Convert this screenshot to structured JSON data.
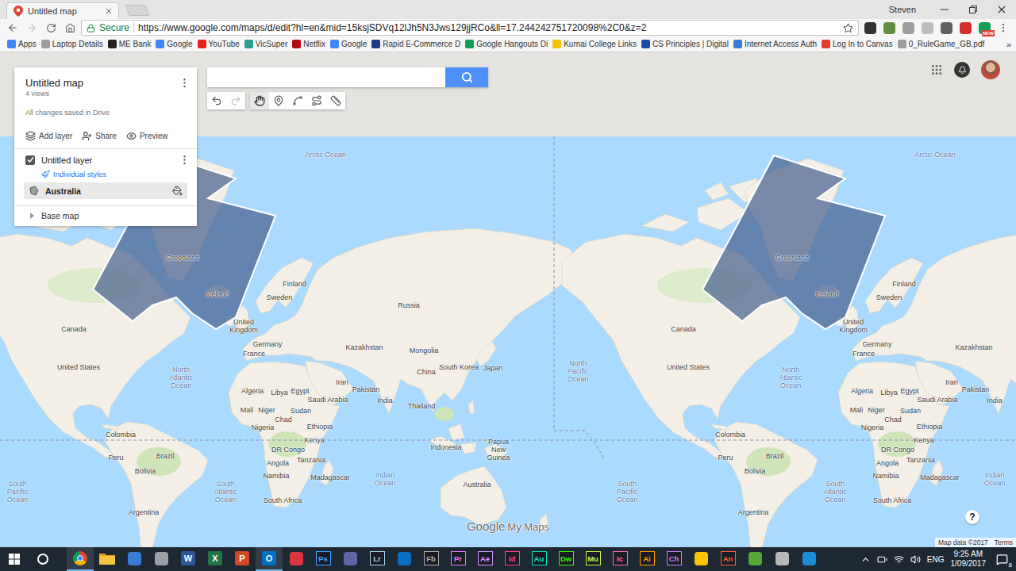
{
  "browser": {
    "tab_title": "Untitled map",
    "profile": "Steven",
    "secure": "Secure",
    "url": "https://www.google.com/maps/d/edit?hl=en&mid=15ksjSDVq12lJh5N3Jws129jjRCo&ll=17.244242751720098%2C0&z=2",
    "can_go_forward": false,
    "starred": false,
    "extensions": [
      {
        "color": "#333333"
      },
      {
        "color": "#5f8f3f"
      },
      {
        "color": "#9e9e9e"
      },
      {
        "color": "#bdbdbd"
      },
      {
        "color": "#616161"
      },
      {
        "color": "#d32f2f"
      },
      {
        "color": "#0f9d58",
        "badge": "NEW"
      }
    ],
    "bookmarks": [
      {
        "label": "Apps",
        "color": "#4285f4"
      },
      {
        "label": "Laptop Details",
        "color": "#9e9e9e"
      },
      {
        "label": "ME Bank",
        "color": "#222222"
      },
      {
        "label": "Google",
        "color": "#4285f4"
      },
      {
        "label": "YouTube",
        "color": "#e62117"
      },
      {
        "label": "VicSuper",
        "color": "#2a9d8f"
      },
      {
        "label": "Netflix",
        "color": "#b20710"
      },
      {
        "label": "Google",
        "color": "#4285f4"
      },
      {
        "label": "Rapid E-Commerce D",
        "color": "#1f3c88"
      },
      {
        "label": "Google Hangouts Di",
        "color": "#0f9d58"
      },
      {
        "label": "Kurnai College Links",
        "color": "#f4c20d"
      },
      {
        "label": "CS Principles | Digital",
        "color": "#1f4aa8"
      },
      {
        "label": "Internet Access Auth",
        "color": "#3b7bd4"
      },
      {
        "label": "Log In to Canvas",
        "color": "#e13f2b"
      },
      {
        "label": "0_RuleGame_GB.pdf",
        "color": "#9e9e9e"
      }
    ],
    "more": "»"
  },
  "map_panel": {
    "title": "Untitled map",
    "views": "4 views",
    "save_status": "All changes saved in Drive",
    "actions": [
      {
        "label": "Add layer",
        "kind": "layer"
      },
      {
        "label": "Share",
        "kind": "share"
      },
      {
        "label": "Preview",
        "kind": "preview"
      }
    ],
    "layers": [
      {
        "name": "Untitled layer",
        "checked": true,
        "style": "Individual styles",
        "features": [
          {
            "name": "Australia",
            "selected": true
          }
        ]
      }
    ],
    "base_map": {
      "label": "Base map",
      "expanded": false
    }
  },
  "tools": {
    "history": [
      {
        "kind": "undo",
        "disabled": false
      },
      {
        "kind": "redo",
        "disabled": true
      }
    ],
    "modes": [
      {
        "kind": "hand",
        "selected": true
      },
      {
        "kind": "marker",
        "selected": false
      },
      {
        "kind": "line",
        "selected": false
      },
      {
        "kind": "route",
        "selected": false
      },
      {
        "kind": "ruler",
        "selected": false
      }
    ]
  },
  "map": {
    "labels": [
      {
        "lines": [
          "Arctic Ocean"
        ],
        "kind": "ocean"
      },
      {
        "lines": [
          "Greenland"
        ],
        "kind": "country"
      },
      {
        "lines": [
          "Iceland"
        ],
        "kind": "country"
      },
      {
        "lines": [
          "Finland"
        ],
        "kind": "country"
      },
      {
        "lines": [
          "Sweden"
        ],
        "kind": "country"
      },
      {
        "lines": [
          "Russia"
        ],
        "kind": "country"
      },
      {
        "lines": [
          "United",
          "Kingdom"
        ],
        "kind": "country"
      },
      {
        "lines": [
          "Germany"
        ],
        "kind": "country"
      },
      {
        "lines": [
          "France"
        ],
        "kind": "country"
      },
      {
        "lines": [
          "Kazakhstan"
        ],
        "kind": "country"
      },
      {
        "lines": [
          "Mongolia"
        ],
        "kind": "country"
      },
      {
        "lines": [
          "China"
        ],
        "kind": "country"
      },
      {
        "lines": [
          "South Korea"
        ],
        "kind": "country"
      },
      {
        "lines": [
          "Japan"
        ],
        "kind": "country"
      },
      {
        "lines": [
          "Canada"
        ],
        "kind": "country"
      },
      {
        "lines": [
          "United States"
        ],
        "kind": "country"
      },
      {
        "lines": [
          "North",
          "Atlantic",
          "Ocean"
        ],
        "kind": "ocean"
      },
      {
        "lines": [
          "Algeria"
        ],
        "kind": "country"
      },
      {
        "lines": [
          "Libya"
        ],
        "kind": "country"
      },
      {
        "lines": [
          "Egypt"
        ],
        "kind": "country"
      },
      {
        "lines": [
          "Saudi Arabia"
        ],
        "kind": "country"
      },
      {
        "lines": [
          "Iran"
        ],
        "kind": "country"
      },
      {
        "lines": [
          "Pakistan"
        ],
        "kind": "country"
      },
      {
        "lines": [
          "India"
        ],
        "kind": "country"
      },
      {
        "lines": [
          "Thailand"
        ],
        "kind": "country"
      },
      {
        "lines": [
          "Mali"
        ],
        "kind": "country"
      },
      {
        "lines": [
          "Niger"
        ],
        "kind": "country"
      },
      {
        "lines": [
          "Sudan"
        ],
        "kind": "country"
      },
      {
        "lines": [
          "Chad"
        ],
        "kind": "country"
      },
      {
        "lines": [
          "Ethiopia"
        ],
        "kind": "country"
      },
      {
        "lines": [
          "Nigeria"
        ],
        "kind": "country"
      },
      {
        "lines": [
          "Kenya"
        ],
        "kind": "country"
      },
      {
        "lines": [
          "DR Congo"
        ],
        "kind": "country"
      },
      {
        "lines": [
          "Tanzania"
        ],
        "kind": "country"
      },
      {
        "lines": [
          "Angola"
        ],
        "kind": "country"
      },
      {
        "lines": [
          "Namibia"
        ],
        "kind": "country"
      },
      {
        "lines": [
          "Madagascar"
        ],
        "kind": "country"
      },
      {
        "lines": [
          "South Africa"
        ],
        "kind": "country"
      },
      {
        "lines": [
          "Colombia"
        ],
        "kind": "country"
      },
      {
        "lines": [
          "Peru"
        ],
        "kind": "country"
      },
      {
        "lines": [
          "Brazil"
        ],
        "kind": "country"
      },
      {
        "lines": [
          "Bolivia"
        ],
        "kind": "country"
      },
      {
        "lines": [
          "Argentina"
        ],
        "kind": "country"
      },
      {
        "lines": [
          "South",
          "Pacific",
          "Ocean"
        ],
        "kind": "ocean"
      },
      {
        "lines": [
          "South",
          "Atlantic",
          "Ocean"
        ],
        "kind": "ocean"
      },
      {
        "lines": [
          "Indian",
          "Ocean"
        ],
        "kind": "ocean"
      },
      {
        "lines": [
          "Indonesia"
        ],
        "kind": "country"
      },
      {
        "lines": [
          "Papua",
          "New",
          "Guinea"
        ],
        "kind": "country"
      },
      {
        "lines": [
          "Australia"
        ],
        "kind": "country"
      },
      {
        "lines": [
          "North",
          "Pacific",
          "Ocean"
        ],
        "kind": "ocean"
      }
    ]
  },
  "map_controls": {
    "zoom_in": "+",
    "zoom_out": "−",
    "help": "?",
    "logo": "Google",
    "logo_product": "My Maps",
    "attribution": "Map data ©2017",
    "terms": "Terms"
  },
  "taskbar": {
    "apps": [
      {
        "kind": "chrome",
        "active": true
      },
      {
        "kind": "folder",
        "active": false
      },
      {
        "kind": "glyph",
        "color": "#3a7bd5",
        "active": false
      },
      {
        "kind": "glyph",
        "color": "#9aa0a6",
        "active": false
      },
      {
        "kind": "office",
        "label": "W",
        "color": "#2b579a",
        "active": false
      },
      {
        "kind": "office",
        "label": "X",
        "color": "#217346",
        "active": false
      },
      {
        "kind": "office",
        "label": "P",
        "color": "#d24726",
        "active": false
      },
      {
        "kind": "office",
        "label": "O",
        "color": "#0072c6",
        "active": true
      },
      {
        "kind": "glyph",
        "color": "#d7373f",
        "active": false
      },
      {
        "kind": "adobe",
        "label": "Ps",
        "color": "#31a8ff",
        "active": false
      },
      {
        "kind": "glyph",
        "color": "#6264a7",
        "active": false
      },
      {
        "kind": "adobe",
        "label": "Lr",
        "color": "#add5ec",
        "active": false
      },
      {
        "kind": "glyph",
        "color": "#0a6fc2",
        "active": false
      },
      {
        "kind": "adobe",
        "label": "Fb",
        "color": "#b0b0b0",
        "active": false
      },
      {
        "kind": "adobe",
        "label": "Pr",
        "color": "#e77bff",
        "active": false
      },
      {
        "kind": "adobe",
        "label": "Ae",
        "color": "#d291ff",
        "active": false
      },
      {
        "kind": "adobe",
        "label": "Id",
        "color": "#ff3f94",
        "active": false
      },
      {
        "kind": "adobe",
        "label": "Au",
        "color": "#00e4bb",
        "active": false
      },
      {
        "kind": "adobe",
        "label": "Dw",
        "color": "#35fa00",
        "active": false
      },
      {
        "kind": "adobe",
        "label": "Mu",
        "color": "#c4f24a",
        "active": false
      },
      {
        "kind": "adobe",
        "label": "Ic",
        "color": "#ff66c4",
        "active": false
      },
      {
        "kind": "adobe",
        "label": "Ai",
        "color": "#ff9a00",
        "active": false
      },
      {
        "kind": "adobe",
        "label": "Ch",
        "color": "#c77dff",
        "active": false
      },
      {
        "kind": "glyph",
        "color": "#f7c600",
        "active": false
      },
      {
        "kind": "adobe",
        "label": "An",
        "color": "#ff5e3a",
        "active": false
      },
      {
        "kind": "glyph",
        "color": "#57a639",
        "active": false
      },
      {
        "kind": "glyph",
        "color": "#b8b8b8",
        "active": false
      },
      {
        "kind": "glyph",
        "color": "#1a8cd8",
        "active": false
      }
    ],
    "language": "ENG",
    "time": "9:25 AM",
    "date": "1/09/2017",
    "notifications": "8"
  }
}
